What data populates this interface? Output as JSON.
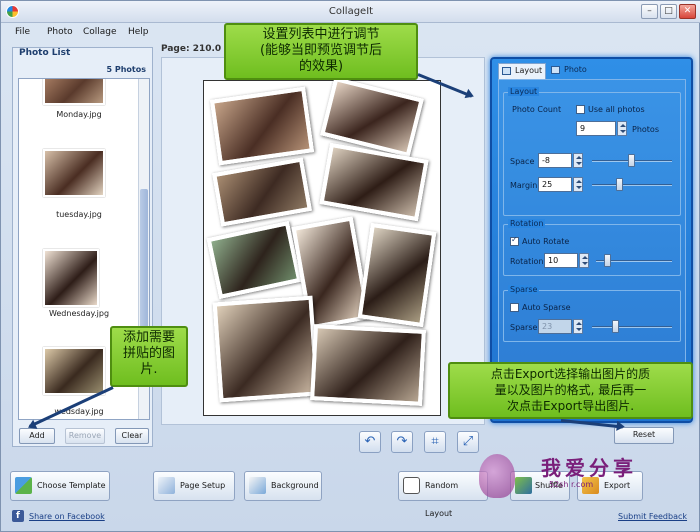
{
  "window": {
    "title": "CollageIt",
    "minimize": "–",
    "maximize": "□",
    "close": "✕"
  },
  "menu": [
    "File",
    "Photo",
    "Collage",
    "Help"
  ],
  "photo_list": {
    "title": "Photo List",
    "count": "5 Photos",
    "items": [
      "Monday.jpg",
      "tuesday.jpg",
      "Wednesday.jpg",
      "wedsday.jpg"
    ],
    "buttons": {
      "add": "Add",
      "remove": "Remove",
      "clear": "Clear"
    }
  },
  "canvas": {
    "page_label": "Page: 210.0 x 297.0"
  },
  "tools": {
    "undo": "↶",
    "redo": "↷",
    "crop": "⌗",
    "fit": "⤢"
  },
  "panel": {
    "tabs": [
      "Layout",
      "Photo"
    ],
    "layout": {
      "title": "Layout",
      "photo_count_label": "Photo Count",
      "use_all_label": "Use all photos",
      "use_all_checked": false,
      "photo_count": "9",
      "photos_unit": "Photos",
      "space_label": "Space",
      "space": "-8",
      "margin_label": "Margin",
      "margin": "25"
    },
    "rotation": {
      "title": "Rotation",
      "auto_label": "Auto Rotate",
      "auto_checked": true,
      "rotation_label": "Rotation",
      "rotation": "10"
    },
    "sparse": {
      "title": "Sparse",
      "auto_label": "Auto Sparse",
      "auto_checked": false,
      "sparse_label": "Sparse",
      "sparse": "23"
    },
    "reset": "Reset"
  },
  "annotations": {
    "top": "设置列表中进行调节\n(能够当即预览调节后\n的效果)",
    "left": "添加需要\n拼贴的图\n片.",
    "bottom": "点击Export选择输出图片的质\n量以及图片的格式, 最后再一\n次点击Export导出图片."
  },
  "bottom_bar": {
    "choose_template": "Choose Template",
    "page_setup": "Page Setup",
    "background": "Background",
    "random_layout": "Random Layout",
    "shuffle": "Shuffle",
    "export": "Export"
  },
  "links": {
    "facebook": "Share on Facebook",
    "feedback": "Submit Feedback"
  },
  "watermark": {
    "title": "我爱分享",
    "sub": "52sh r.com"
  },
  "colors": {
    "panel": "#2a86e0",
    "callout": "#8fd13b",
    "arrow": "#1b3f78"
  }
}
